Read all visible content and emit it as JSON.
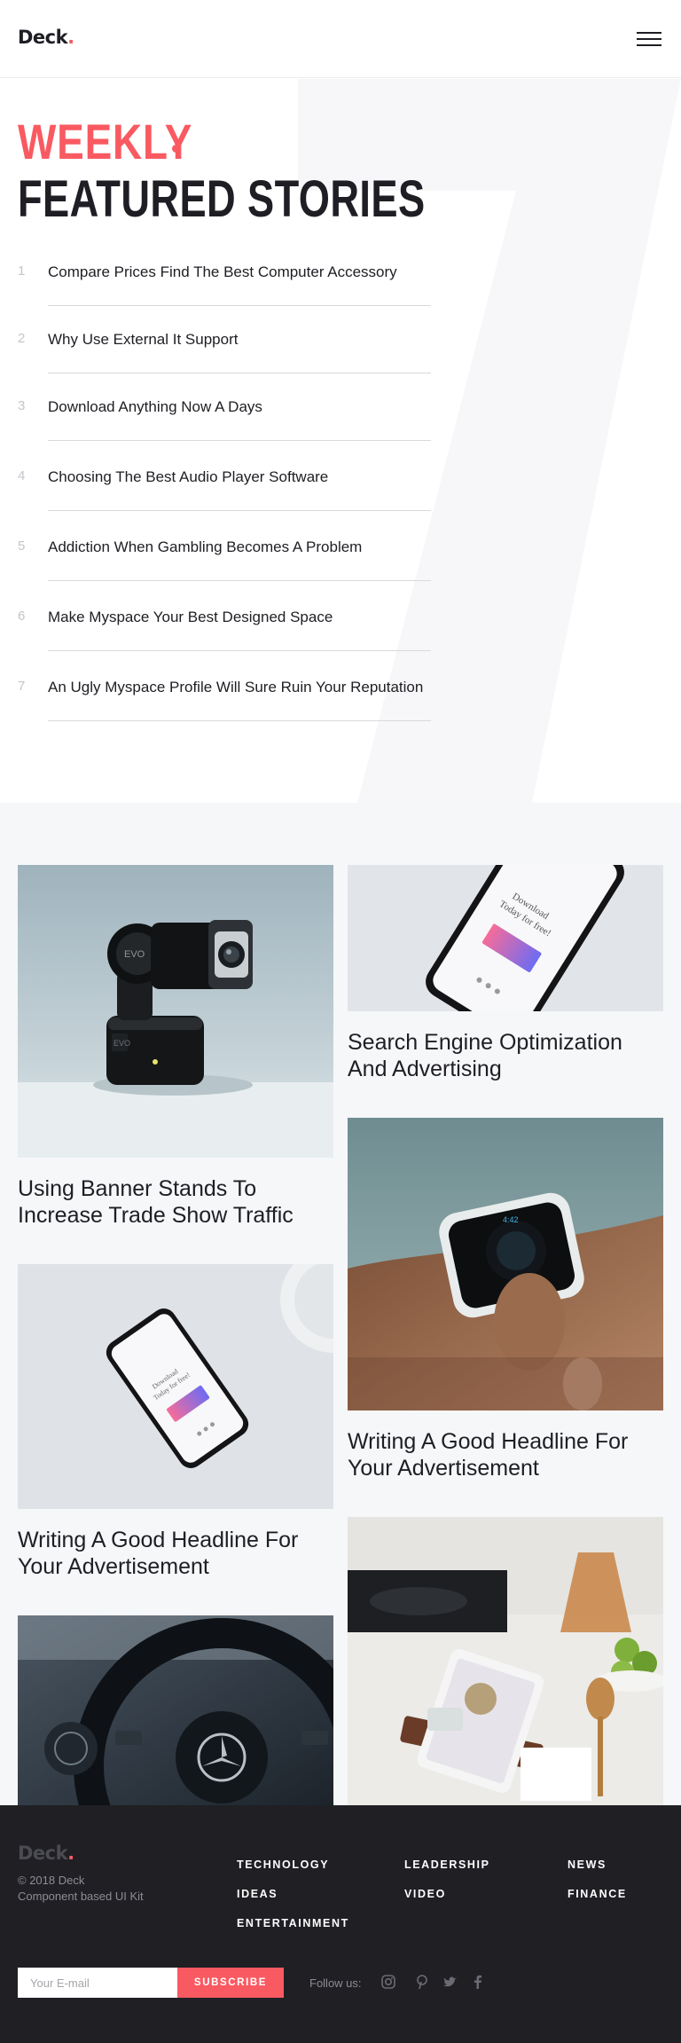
{
  "header": {
    "logo_text": "Deck",
    "logo_dot": ".",
    "menu_icon": "hamburger-menu-icon"
  },
  "featured": {
    "heading_top": "WEEKLY",
    "heading_bottom": "FEATURED STORIES",
    "stories": [
      {
        "num": "1",
        "title": "Compare Prices Find The Best Computer Accessory"
      },
      {
        "num": "2",
        "title": "Why Use External It Support"
      },
      {
        "num": "3",
        "title": "Download Anything Now A Days"
      },
      {
        "num": "4",
        "title": "Choosing The Best Audio Player Software"
      },
      {
        "num": "5",
        "title": "Addiction When Gambling Becomes A Problem"
      },
      {
        "num": "6",
        "title": "Make Myspace Your Best Designed Space"
      },
      {
        "num": "7",
        "title": "An Ugly Myspace Profile Will Sure Ruin Your Reputation"
      }
    ]
  },
  "cards": [
    {
      "title": "Using Banner Stands To Increase Trade Show Traffic",
      "image": "gimbal-camera-photo"
    },
    {
      "title": "Search Engine Optimization And Advertising",
      "image": "phone-download-photo"
    },
    {
      "title": "Writing A Good Headline For Your Advertisement",
      "image": "smartwatch-photo"
    },
    {
      "title": "Writing A Good Headline For Your Advertisement",
      "image": "phone-on-desk-photo"
    },
    {
      "title": "",
      "image": "car-steering-wheel-photo"
    },
    {
      "title": "",
      "image": "tablet-kitchen-photo"
    }
  ],
  "image_text": {
    "phone_line1": "Download",
    "phone_line2": "Today for free!",
    "camera_brand": "EVO",
    "watch_time": "4:42"
  },
  "footer": {
    "logo_text": "Deck",
    "logo_dot": ".",
    "copyright": "© 2018 Deck",
    "tagline": "Component based UI Kit",
    "links": [
      "TECHNOLOGY",
      "LEADERSHIP",
      "NEWS",
      "IDEAS",
      "VIDEO",
      "FINANCE",
      "ENTERTAINMENT"
    ],
    "email_placeholder": "Your E-mail",
    "subscribe_label": "SUBSCRIBE",
    "follow_label": "Follow us:",
    "social_icons": [
      "instagram-icon",
      "pinterest-icon",
      "twitter-icon",
      "facebook-icon"
    ]
  },
  "colors": {
    "accent": "#f95a61",
    "dark": "#1e1e24",
    "footer_bg": "#1f1f24",
    "grid_bg": "#f6f7f9"
  }
}
